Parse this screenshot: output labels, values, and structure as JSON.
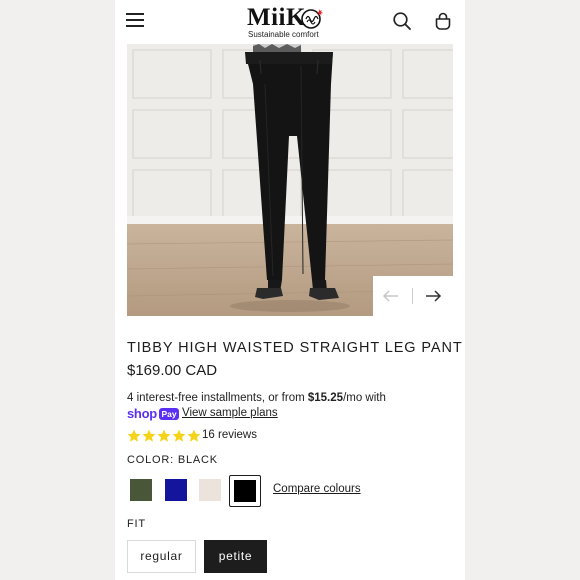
{
  "header": {
    "logo_text": "MiiK",
    "tagline": "Sustainable comfort",
    "icons": [
      "menu-icon",
      "search-icon",
      "bag-icon"
    ]
  },
  "product": {
    "title": "TIBBY HIGH WAISTED STRAIGHT LEG PANT",
    "price": "$169.00 CAD",
    "installments_prefix": "4 interest-free installments, or from ",
    "installments_amount": "$15.25",
    "installments_suffix": "/mo with",
    "shop_pay_shop": "shop",
    "shop_pay_pay": "Pay",
    "sample_plans_link": "View sample plans",
    "rating": 5,
    "reviews_label": "16 reviews",
    "color_label": "COLOR: BLACK",
    "colors": [
      {
        "name": "olive",
        "hex": "#4a5638"
      },
      {
        "name": "navy",
        "hex": "#13159a"
      },
      {
        "name": "blush",
        "hex": "#ece3dd"
      },
      {
        "name": "black",
        "hex": "#000000",
        "selected": true
      }
    ],
    "compare_link": "Compare colours",
    "fit_label": "FIT",
    "fit_options": [
      {
        "label": "regular",
        "selected": false
      },
      {
        "label": "petite",
        "selected": true
      }
    ]
  },
  "theme": {
    "star_color": "#f5d318",
    "shop_pay_purple": "#5a31f4",
    "selected_bg": "#1d1d1d"
  }
}
